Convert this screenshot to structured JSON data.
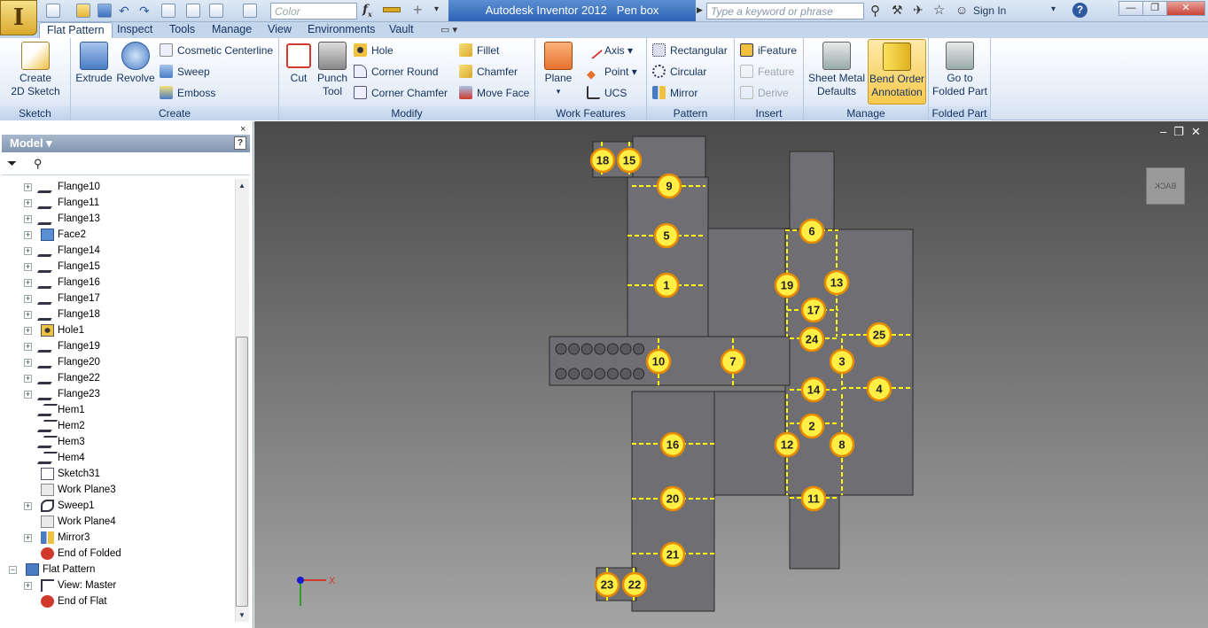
{
  "app": {
    "title": "Autodesk Inventor 2012",
    "document": "Pen box",
    "color_placeholder": "Color",
    "search_placeholder": "Type a keyword or phrase",
    "sign_in": "Sign In",
    "help": "?"
  },
  "tabs": [
    {
      "label": "Flat Pattern",
      "active": true
    },
    {
      "label": "Inspect"
    },
    {
      "label": "Tools"
    },
    {
      "label": "Manage"
    },
    {
      "label": "View"
    },
    {
      "label": "Environments"
    },
    {
      "label": "Vault"
    }
  ],
  "ribbon": {
    "sketch": {
      "label": "Sketch",
      "create": "Create",
      "create2": "2D Sketch"
    },
    "create": {
      "label": "Create",
      "extrude": "Extrude",
      "revolve": "Revolve",
      "cosmetic": "Cosmetic Centerline",
      "sweep": "Sweep",
      "emboss": "Emboss"
    },
    "modify": {
      "label": "Modify",
      "cut": "Cut",
      "punch1": "Punch",
      "punch2": "Tool",
      "hole": "Hole",
      "corner_round": "Corner Round",
      "corner_chamfer": "Corner Chamfer",
      "fillet": "Fillet",
      "chamfer": "Chamfer",
      "move_face": "Move Face"
    },
    "work": {
      "label": "Work Features",
      "plane": "Plane",
      "axis": "Axis",
      "point": "Point",
      "ucs": "UCS"
    },
    "pattern": {
      "label": "Pattern",
      "rect": "Rectangular",
      "circ": "Circular",
      "mirror": "Mirror"
    },
    "insert": {
      "label": "Insert",
      "ifeature": "iFeature",
      "feature": "Feature",
      "derive": "Derive"
    },
    "manage": {
      "label": "Manage",
      "smd1": "Sheet Metal",
      "smd2": "Defaults",
      "bo1": "Bend Order",
      "bo2": "Annotation"
    },
    "folded": {
      "label": "Folded Part",
      "go1": "Go to",
      "go2": "Folded Part"
    }
  },
  "browser": {
    "title": "Model",
    "close": "×",
    "help": "?",
    "nodes": [
      {
        "label": "Flange10",
        "icon": "flange-icon",
        "exp": "+"
      },
      {
        "label": "Flange11",
        "icon": "flange-icon",
        "exp": "+"
      },
      {
        "label": "Flange13",
        "icon": "flange-icon",
        "exp": "+"
      },
      {
        "label": "Face2",
        "icon": "face-icon",
        "exp": "+"
      },
      {
        "label": "Flange14",
        "icon": "flange-icon",
        "exp": "+"
      },
      {
        "label": "Flange15",
        "icon": "flange-icon",
        "exp": "+"
      },
      {
        "label": "Flange16",
        "icon": "flange-icon",
        "exp": "+"
      },
      {
        "label": "Flange17",
        "icon": "flange-icon",
        "exp": "+"
      },
      {
        "label": "Flange18",
        "icon": "flange-icon",
        "exp": "+"
      },
      {
        "label": "Hole1",
        "icon": "hole-icon",
        "exp": "+"
      },
      {
        "label": "Flange19",
        "icon": "flange-icon",
        "exp": "+"
      },
      {
        "label": "Flange20",
        "icon": "flange-icon",
        "exp": "+"
      },
      {
        "label": "Flange22",
        "icon": "flange-icon",
        "exp": "+"
      },
      {
        "label": "Flange23",
        "icon": "flange-icon",
        "exp": "+"
      },
      {
        "label": "Hem1",
        "icon": "hem-icon",
        "exp": ""
      },
      {
        "label": "Hem2",
        "icon": "hem-icon",
        "exp": ""
      },
      {
        "label": "Hem3",
        "icon": "hem-icon",
        "exp": ""
      },
      {
        "label": "Hem4",
        "icon": "hem-icon",
        "exp": ""
      },
      {
        "label": "Sketch31",
        "icon": "sketch-icon",
        "exp": ""
      },
      {
        "label": "Work Plane3",
        "icon": "workplane-icon",
        "exp": ""
      },
      {
        "label": "Sweep1",
        "icon": "sweep-icon",
        "exp": "+"
      },
      {
        "label": "Work Plane4",
        "icon": "workplane-icon",
        "exp": ""
      },
      {
        "label": "Mirror3",
        "icon": "mirror-icon",
        "exp": "+"
      },
      {
        "label": "End of Folded",
        "icon": "end-icon",
        "exp": ""
      },
      {
        "label": "Flat Pattern",
        "icon": "flatpattern-icon",
        "exp": "-",
        "root": true
      },
      {
        "label": "View: Master",
        "icon": "view-icon",
        "exp": "+"
      },
      {
        "label": "End of Flat",
        "icon": "end-icon",
        "exp": ""
      }
    ]
  },
  "viewcube": {
    "face": "BACK"
  },
  "triad": {
    "x": "X"
  },
  "bend_labels": [
    {
      "n": "18"
    },
    {
      "n": "15"
    },
    {
      "n": "9"
    },
    {
      "n": "5"
    },
    {
      "n": "1"
    },
    {
      "n": "6"
    },
    {
      "n": "19"
    },
    {
      "n": "13"
    },
    {
      "n": "17"
    },
    {
      "n": "24"
    },
    {
      "n": "25"
    },
    {
      "n": "10"
    },
    {
      "n": "7"
    },
    {
      "n": "3"
    },
    {
      "n": "14"
    },
    {
      "n": "4"
    },
    {
      "n": "2"
    },
    {
      "n": "16"
    },
    {
      "n": "12"
    },
    {
      "n": "8"
    },
    {
      "n": "20"
    },
    {
      "n": "11"
    },
    {
      "n": "21"
    },
    {
      "n": "23"
    },
    {
      "n": "22"
    }
  ],
  "colors": {
    "ribbon_active": "#f8c94e",
    "bend_fill": "#ffee44",
    "bend_stroke": "#e88a00",
    "bend_line": "#ffff00",
    "part": "#6f6f73"
  }
}
